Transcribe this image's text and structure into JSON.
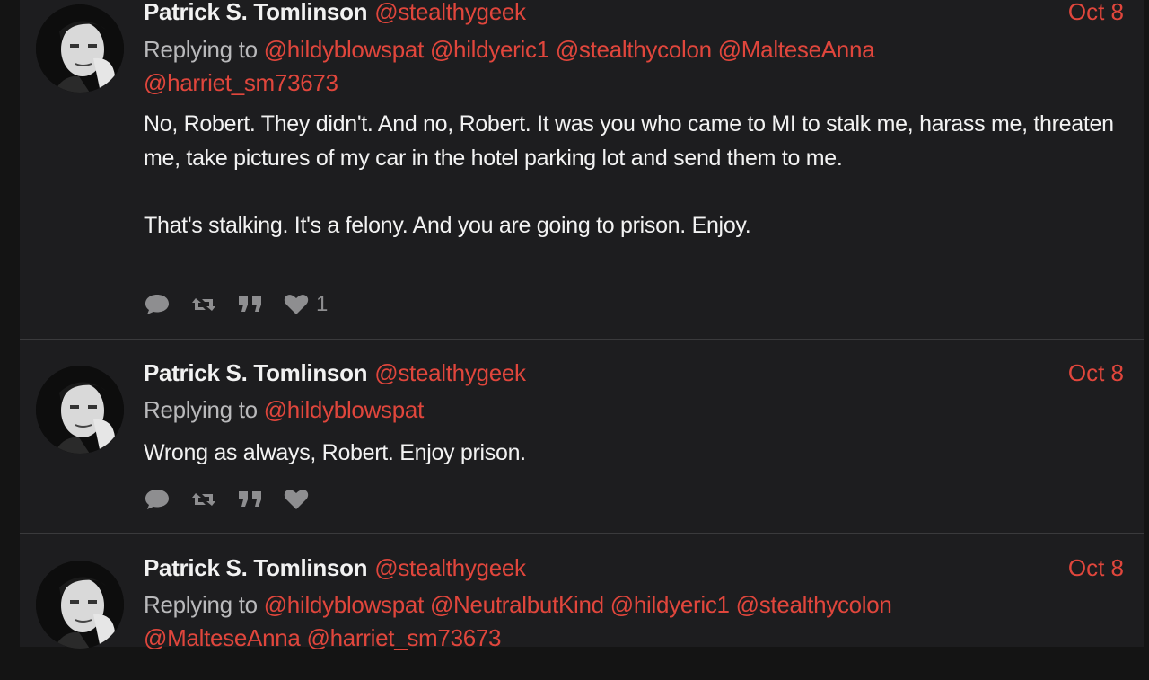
{
  "tweets": [
    {
      "author_name": "Patrick S. Tomlinson",
      "author_handle": "@stealthygeek",
      "date": "Oct 8",
      "replying_prefix": "Replying to",
      "mentions": [
        "@hildyblowspat",
        "@hildyeric1",
        "@stealthycolon",
        "@MalteseAnna",
        "@harriet_sm73673"
      ],
      "body": "No, Robert. They didn't. And no, Robert. It was you who came to MI to stalk me, harass me, threaten me, take pictures of my car in the hotel parking lot and send them to me.\n\nThat's stalking. It's a felony. And you are going to prison. Enjoy.",
      "like_count": "1"
    },
    {
      "author_name": "Patrick S. Tomlinson",
      "author_handle": "@stealthygeek",
      "date": "Oct 8",
      "replying_prefix": "Replying to",
      "mentions": [
        "@hildyblowspat"
      ],
      "body": "Wrong as always, Robert. Enjoy prison.",
      "like_count": ""
    },
    {
      "author_name": "Patrick S. Tomlinson",
      "author_handle": "@stealthygeek",
      "date": "Oct 8",
      "replying_prefix": "Replying to",
      "mentions": [
        "@hildyblowspat",
        "@NeutralbutKind",
        "@hildyeric1",
        "@stealthycolon",
        "@MalteseAnna",
        "@harriet_sm73673"
      ],
      "body": "",
      "like_count": ""
    }
  ],
  "icons": {
    "reply": "speech-bubble-icon",
    "retweet": "retweet-icon",
    "quote": "quote-icon",
    "like": "heart-icon"
  },
  "colors": {
    "accent": "#e0463c",
    "background": "#1d1d1f",
    "text": "#f2f2f2",
    "muted": "#8e8e90"
  }
}
